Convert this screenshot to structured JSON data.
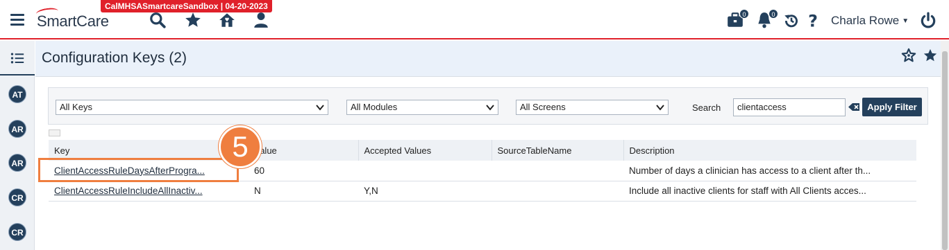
{
  "env_badge": "CalMHSASmartcareSandbox | 04-20-2023",
  "app": {
    "logo_text": "SmartCare"
  },
  "header_icons": [
    "search-icon",
    "star-icon",
    "home-icon",
    "user-icon"
  ],
  "notifications": {
    "briefcase_count": "0",
    "bell_count": "0"
  },
  "user": {
    "name": "Charla Rowe"
  },
  "left_rail": {
    "avatars": [
      "AT",
      "AR",
      "AR",
      "CR",
      "CR"
    ]
  },
  "page": {
    "title": "Configuration Keys (2)"
  },
  "filters": {
    "keys": "All Keys",
    "modules": "All Modules",
    "screens": "All Screens",
    "search_label": "Search",
    "search_value": "clientaccess",
    "apply_label": "Apply Filter"
  },
  "table": {
    "columns": [
      "Key",
      "Value",
      "Accepted Values",
      "SourceTableName",
      "Description"
    ],
    "rows": [
      {
        "key": "ClientAccessRuleDaysAfterProgra...",
        "value": "60",
        "accepted": "",
        "source": "",
        "description": "Number of days a clinician has access to a client after th..."
      },
      {
        "key": "ClientAccessRuleIncludeAllInactiv...",
        "value": "N",
        "accepted": "Y,N",
        "source": "",
        "description": "Include all inactive clients for staff with All Clients acces..."
      }
    ]
  },
  "annotation": {
    "step": "5"
  },
  "colors": {
    "accent": "#e0202a",
    "primary": "#24405c",
    "annotation": "#ef7e3f"
  }
}
